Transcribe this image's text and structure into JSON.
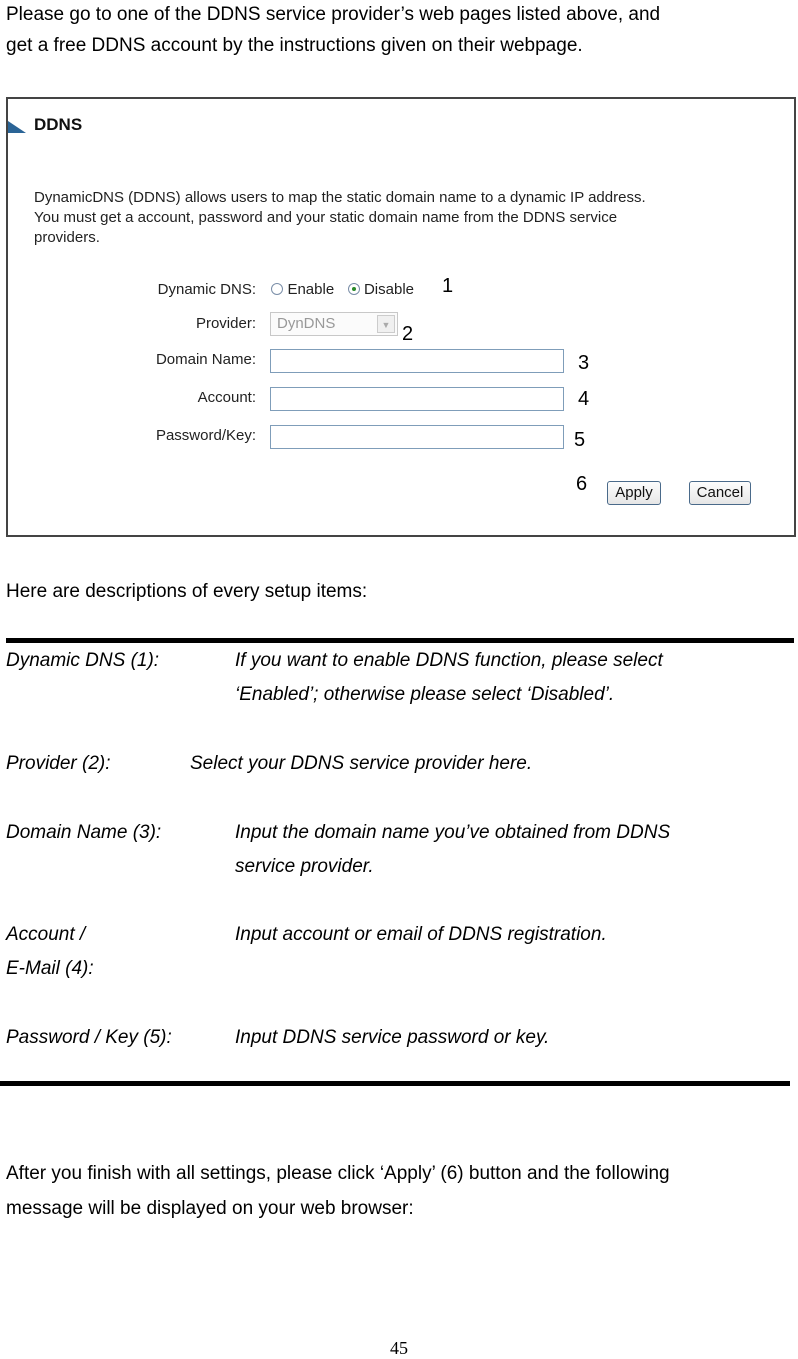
{
  "intro": {
    "line1": "Please go to one of the DDNS service provider’s web pages listed above, and",
    "line2": "get a free DDNS account by the instructions given on their webpage."
  },
  "screenshot": {
    "title": "DDNS",
    "description": [
      "DynamicDNS (DDNS) allows users to map the static domain name to a dynamic IP address.",
      "You must get a account, password and your static domain name from the DDNS service",
      "providers."
    ],
    "fields": {
      "dynamic_dns": {
        "label": "Dynamic DNS:",
        "options": [
          "Enable",
          "Disable"
        ],
        "selected": "Disable",
        "callout": "1"
      },
      "provider": {
        "label": "Provider:",
        "value": "DynDNS",
        "callout": "2"
      },
      "domain_name": {
        "label": "Domain Name:",
        "value": "",
        "callout": "3"
      },
      "account": {
        "label": "Account:",
        "value": "",
        "callout": "4"
      },
      "password": {
        "label": "Password/Key:",
        "value": "",
        "callout": "5"
      }
    },
    "buttons": {
      "callout": "6",
      "apply": "Apply",
      "cancel": "Cancel"
    }
  },
  "descriptions_heading": "Here are descriptions of every setup items:",
  "items": [
    {
      "term": "Dynamic DNS (1):",
      "desc1": "If you want to enable DDNS function, please select",
      "desc2": "‘Enabled’; otherwise please select ‘Disabled’."
    },
    {
      "term": "Provider (2):",
      "desc1": "Select your DDNS service provider here."
    },
    {
      "term": "Domain Name (3):",
      "desc1": "Input the domain name you’ve obtained from DDNS",
      "desc2": "service provider."
    },
    {
      "term": "Account /",
      "term2": "E-Mail (4):",
      "desc1": "Input account or email of DDNS registration."
    },
    {
      "term": "Password / Key (5):",
      "desc1": "Input DDNS service password or key."
    }
  ],
  "outro": {
    "line1": "After you finish with all settings, please click ‘Apply’ (6) button and the following",
    "line2": "message will be displayed on your web browser:"
  },
  "page_number": "45"
}
